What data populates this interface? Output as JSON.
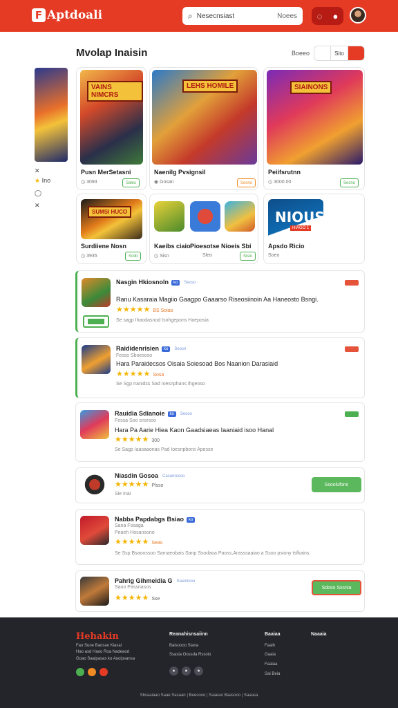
{
  "header": {
    "logo_text": "Aptdoali",
    "search_placeholder": "Nesecnsiast",
    "search_hint": "Noees"
  },
  "section": {
    "title": "Mvolap Inaisin",
    "sort_label": "Boeeo",
    "sort_options": [
      "",
      "Sito",
      ""
    ]
  },
  "side": {
    "items": [
      "Ino"
    ]
  },
  "featured": [
    {
      "title": "Pusn MerSetasni",
      "meta": "3093",
      "badge": "Sales"
    },
    {
      "title": "Naenilg Pvsignsil",
      "meta": "Gosan",
      "badge": "Sesno"
    },
    {
      "title": "Peiifsrutnn",
      "meta": "3000.00",
      "badge": "Sesno"
    },
    {
      "title": "Surdiiene Nosn",
      "meta": "3935",
      "badge": "Soiib"
    },
    {
      "title": "Kaeibs ciaio",
      "meta": "Sisn",
      "badge": ""
    },
    {
      "title": "Pioesotse Nioeis Sbi",
      "meta": "Sleo",
      "badge": "Sislo"
    },
    {
      "title": "Apsdo Ricio",
      "meta": "Soeo",
      "badge": ""
    }
  ],
  "banner_texts": [
    "VAINS NIMCRS",
    "LEHS HOMILE",
    "SIAINONS",
    "SUMSI HUCO"
  ],
  "nious": {
    "title": "NIOUS",
    "sub": "HIAGO 1"
  },
  "list": [
    {
      "name": "Nasgin Hkiosnoln",
      "tag": "ko",
      "muted": "Seoso",
      "desc": "Ranu Kasaraia Magiio Gaagpo Gaaarso Riseosiinoin Aa Haneosto Bsngi.",
      "stars": "★★★★★",
      "extra": "BS Soiao",
      "foot": "Se sagp  Ihaodasnod  Isnhgepons  Haeposia"
    },
    {
      "name": "Raididenrisien",
      "tag": "ko",
      "muted": "Seosn",
      "sub": "Fesso  Sboesoso",
      "desc": "Hara Paraidecsos Oisaia Soiesoad Bos Naanion Darasiaid",
      "stars": "★★★★★",
      "extra": "Sosa",
      "foot": "Se Sgp  Iranidss Sad  Ioesnphans  Ihgeoso"
    },
    {
      "name": "Rauidia Sdianoie",
      "tag": "ko",
      "muted": "Seoso",
      "sub": "Fessa  Soo snsrsoo",
      "desc": "Hara Pa Aarie Hiea Kaon Gaadsiaeas Iaaniaid isoo Hanal",
      "stars": "★★★★★",
      "extra": "300",
      "foot": "Se Sagp  Iaasaaonas Pad  Ioesnpbons  Apesse"
    },
    {
      "name": "Niasdin Gosoa",
      "muted": "Casanresoo",
      "stars": "★★★★★",
      "extra": "Plsso",
      "foot": "Sie Inai",
      "button": "Ssoolufons"
    },
    {
      "name": "Nabba Papdabgs Bsiao",
      "tag": "ko",
      "sub": "Sana Fosaga",
      "sub2": "Peaeh Hosansono",
      "stars": "★★★★★",
      "extra": "Seas",
      "foot": "Se Ssp Bsaoossoo Samaeobais  Sanp Ssodaoa Paoss,Arasssaaiao a Ssoo psiony tsfkains."
    },
    {
      "name": "Pahrig Gihmeidia G",
      "muted": "Saieniooo",
      "sub": "Saoo Passnasos",
      "stars": "★★★★★",
      "extra": "Sse",
      "button": "Sdoso Sxsnia"
    }
  ],
  "footer": {
    "brand": "Hehakin",
    "desc": [
      "Fao Suoe Baosao Kiasai",
      "Hao asd Haoo Roa Nadeaod",
      "Goao Saaipasas ko Auoipsansa"
    ],
    "col1_title": "Reanahisnsaiinn",
    "col1_links": [
      "Baisoooo  Siana",
      "Ssasia  Oossda Rssoio"
    ],
    "col2_title": "Baaiaa",
    "col2_links": [
      "Faaih",
      "Gaaia",
      "Faaiaa",
      "Sai Beia"
    ],
    "col3_title": "Naaaia",
    "bottom": "Sbsaaiaao Saae Sasaan  |  Beesooo  |  Saaeao Baasooo  |  Saaasa"
  },
  "colors": {
    "brand": "#e53a24",
    "accent_green": "#4caf50",
    "star": "#f5b400",
    "footer_bg": "#23252b"
  }
}
